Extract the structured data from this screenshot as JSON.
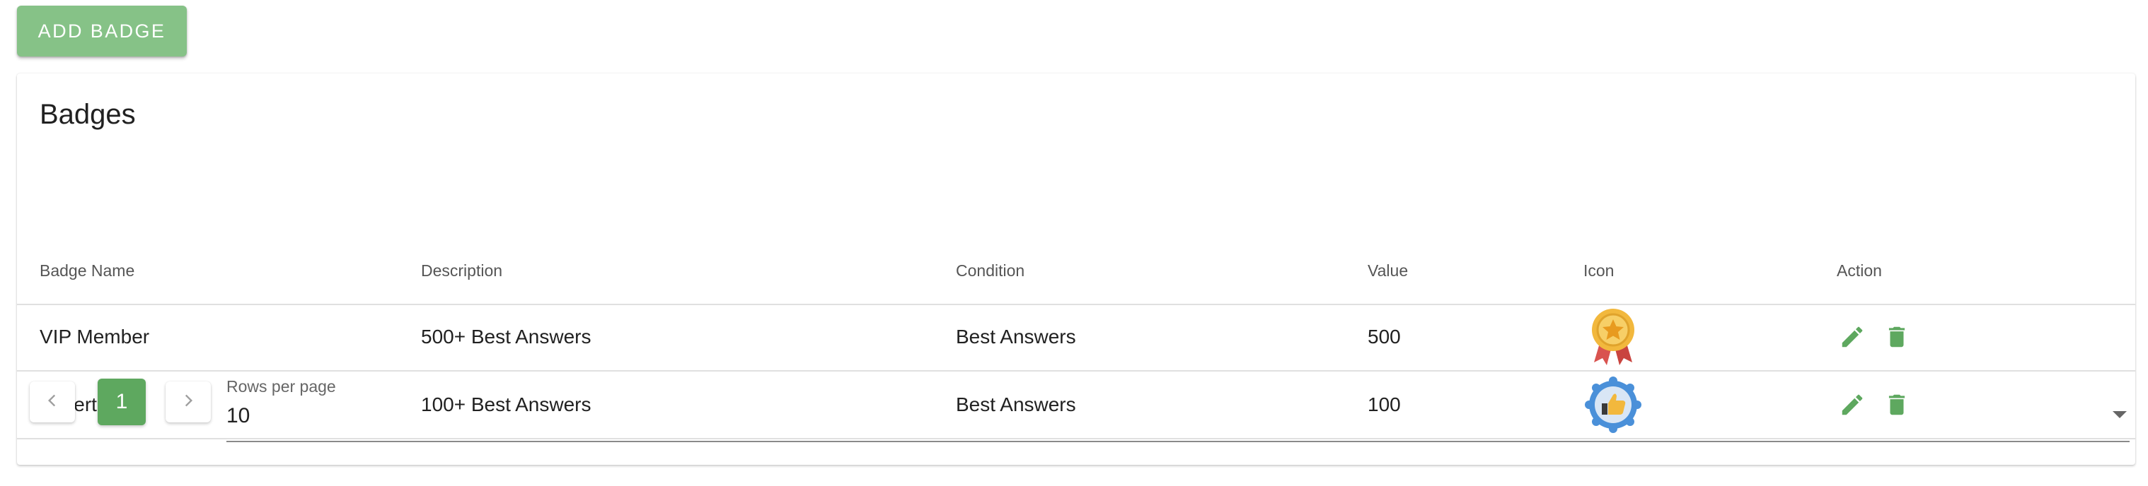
{
  "toolbar": {
    "add_badge_label": "ADD BADGE"
  },
  "card": {
    "title": "Badges"
  },
  "table": {
    "columns": [
      "Badge Name",
      "Description",
      "Condition",
      "Value",
      "Icon",
      "Action"
    ],
    "rows": [
      {
        "name": "VIP Member",
        "description": "500+ Best Answers",
        "condition": "Best Answers",
        "value": "500",
        "icon": "medal-star-icon"
      },
      {
        "name": "Expert",
        "description": "100+ Best Answers",
        "condition": "Best Answers",
        "value": "100",
        "icon": "thumbs-up-badge-icon"
      }
    ],
    "actions": [
      "edit-icon",
      "delete-icon"
    ]
  },
  "pagination": {
    "current_page": "1",
    "rows_per_page_label": "Rows per page",
    "rows_per_page_value": "10"
  },
  "colors": {
    "primary": "#5ea85f",
    "primary_light": "#86c287",
    "action_icon": "#5ea85f",
    "medal_gold": "#f2b83d",
    "medal_ribbon": "#d9534f",
    "thumbs_badge_blue": "#4a90d9"
  }
}
